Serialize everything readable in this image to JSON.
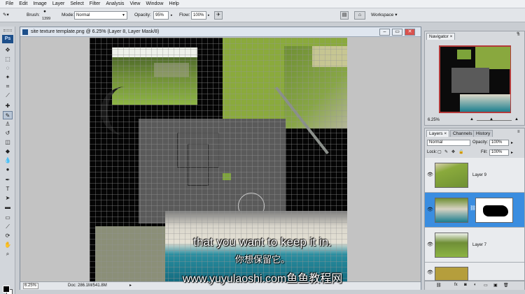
{
  "menu": [
    "File",
    "Edit",
    "Image",
    "Layer",
    "Select",
    "Filter",
    "Analysis",
    "View",
    "Window",
    "Help"
  ],
  "options": {
    "brush_label": "Brush:",
    "brush_size": "1399",
    "mode_label": "Mode:",
    "mode_value": "Normal",
    "opacity_label": "Opacity:",
    "opacity_value": "95%",
    "flow_label": "Flow:",
    "flow_value": "100%",
    "workspace_label": "Workspace ▾"
  },
  "tools": {
    "logo": "Ps"
  },
  "document": {
    "title": "site texture template.png @ 6.25% (Layer 8, Layer Mask/8)",
    "zoom": "6.25%",
    "doc_info": "Doc: 286.1M/541.8M"
  },
  "navigator": {
    "tab": "Navigator",
    "zoom": "6.25%"
  },
  "layers_panel": {
    "tabs": [
      "Layers",
      "Channels",
      "History"
    ],
    "blend_mode": "Normal",
    "opacity_label": "Opacity:",
    "opacity_value": "100%",
    "lock_label": "Lock:",
    "fill_label": "Fill:",
    "fill_value": "100%",
    "layers": [
      {
        "name": "Layer 9",
        "selected": false
      },
      {
        "name": "",
        "selected": true
      },
      {
        "name": "Layer 7",
        "selected": false
      },
      {
        "name": "",
        "selected": false
      }
    ]
  },
  "subtitles": {
    "english": "that you want to keep it in.",
    "chinese": "你想保留它。",
    "watermark": "www.yuyulaoshi.com鱼鱼教程网"
  },
  "colors": {
    "selected_layer": "#3a8de0",
    "grass": "#7da33a",
    "sea": "#1c7f8f",
    "sand": "#e2dccc"
  }
}
